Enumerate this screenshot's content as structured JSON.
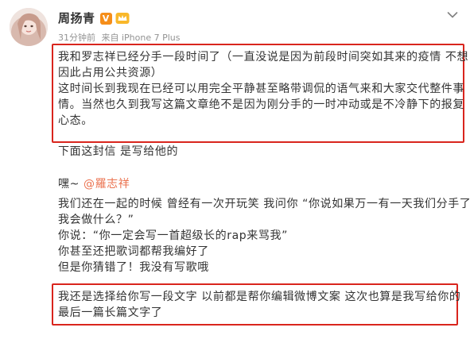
{
  "author": {
    "name": "周扬青",
    "verified_badge": "V"
  },
  "meta": {
    "time": "31分钟前",
    "source": "来自 iPhone 7 Plus"
  },
  "icons": {
    "avatar": "avatar-photo",
    "verified": "verified-v-icon",
    "member": "member-crown-icon",
    "more": "chevron-down-icon"
  },
  "colors": {
    "highlight_border": "#d9251d",
    "mention": "#eb7350",
    "meta_gray": "#939393",
    "verified_orange": "#f58e1a"
  },
  "post": {
    "para1": [
      "我和罗志祥已经分手一段时间了（一直没说是因为前段时间突如其来的疫情 不想",
      "因此占用公共资源）",
      "这时间长到我现在已经可以用完全平静甚至略带调侃的语气来和大家交代整件事",
      "情。当然也久到我写这篇文章绝不是因为刚分手的一时冲动或是不冷静下的报复",
      "心态。"
    ],
    "line_letter": "下面这封信 是写给他的",
    "greeting_prefix": "嘿~ ",
    "greeting_mention": "@羅志祥",
    "body": [
      "我们还在一起的时候 曾经有一次开玩笑 我问你 “你说如果万一有一天我们分手了",
      "我会做什么？”",
      "你说：“你一定会写一首超级长的rap来骂我”",
      "你甚至还把歌词都帮我编好了",
      "但是你猜错了！我没有写歌哦"
    ],
    "para_last": [
      "我还是选择给你写一段文字  以前都是帮你编辑微博文案 这次也算是我写给你的",
      "最后一篇长篇文字了"
    ]
  }
}
